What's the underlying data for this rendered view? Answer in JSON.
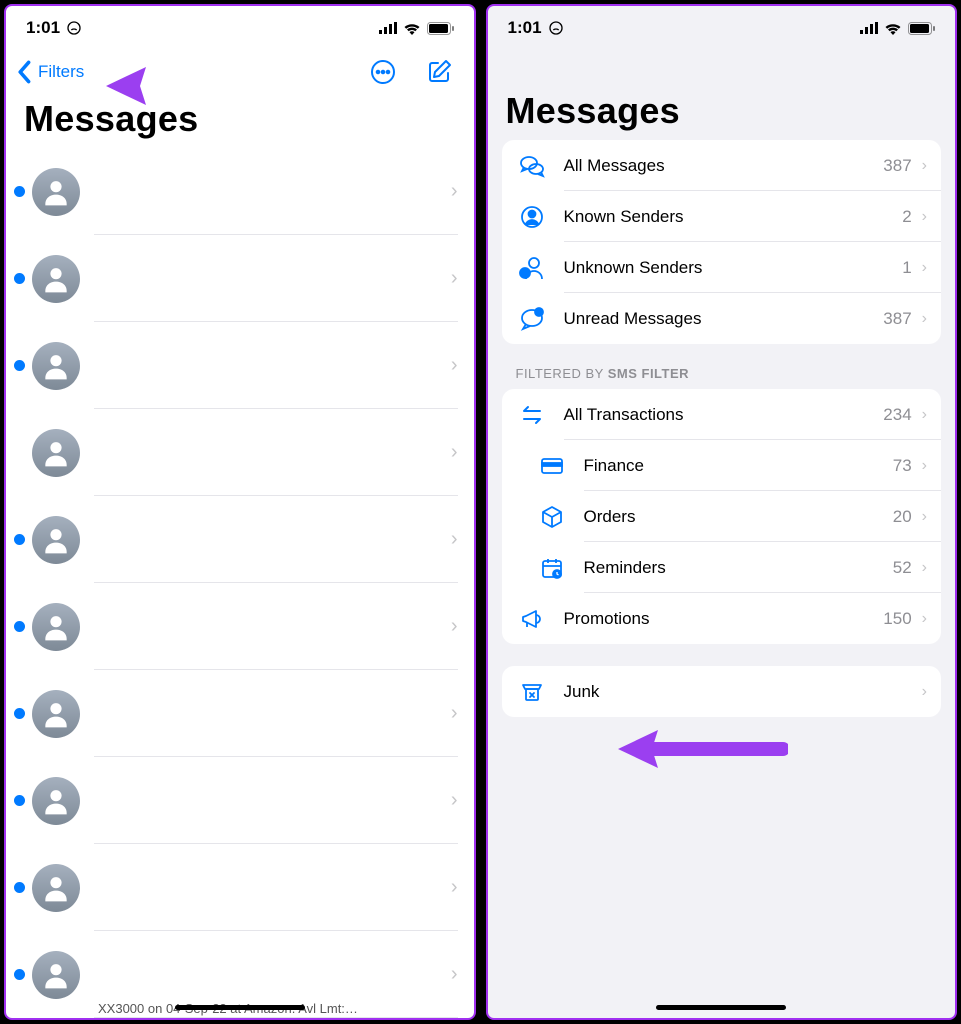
{
  "status": {
    "time": "1:01"
  },
  "nav": {
    "back_label": "Filters"
  },
  "title": "Messages",
  "convos": [
    {
      "unread": true
    },
    {
      "unread": true
    },
    {
      "unread": true
    },
    {
      "unread": false
    },
    {
      "unread": true
    },
    {
      "unread": true
    },
    {
      "unread": true
    },
    {
      "unread": true
    },
    {
      "unread": true
    },
    {
      "unread": true
    }
  ],
  "preview_text": "XX3000 on 04-Sep-22 at Amazon. Avl Lmt:…",
  "filters": {
    "section_label_prefix": "FILTERED BY ",
    "section_label_bold": "SMS FILTER",
    "main": [
      {
        "key": "all",
        "label": "All Messages",
        "count": "387"
      },
      {
        "key": "known",
        "label": "Known Senders",
        "count": "2"
      },
      {
        "key": "unknown",
        "label": "Unknown Senders",
        "count": "1"
      },
      {
        "key": "unread",
        "label": "Unread Messages",
        "count": "387"
      }
    ],
    "categories": [
      {
        "key": "transactions",
        "label": "All Transactions",
        "count": "234",
        "sub": false
      },
      {
        "key": "finance",
        "label": "Finance",
        "count": "73",
        "sub": true
      },
      {
        "key": "orders",
        "label": "Orders",
        "count": "20",
        "sub": true
      },
      {
        "key": "reminders",
        "label": "Reminders",
        "count": "52",
        "sub": true
      },
      {
        "key": "promotions",
        "label": "Promotions",
        "count": "150",
        "sub": false
      }
    ],
    "junk": {
      "label": "Junk"
    }
  }
}
